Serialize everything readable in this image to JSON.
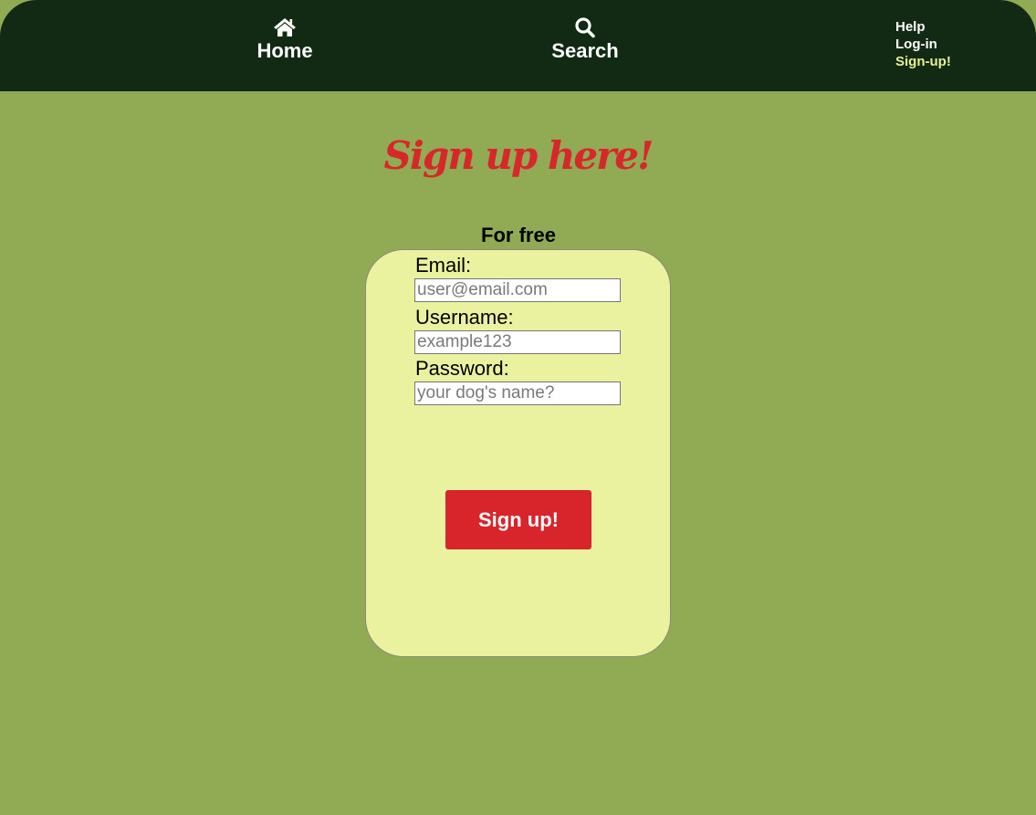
{
  "nav": {
    "home": {
      "label": "Home",
      "icon": "home-icon"
    },
    "search": {
      "label": "Search",
      "icon": "search-icon"
    },
    "links": {
      "help": "Help",
      "login": "Log-in",
      "signup": "Sign-up!"
    }
  },
  "page": {
    "heading": "Sign up here!",
    "subheading": "For free"
  },
  "form": {
    "email": {
      "label": "Email:",
      "placeholder": "user@email.com",
      "value": ""
    },
    "username": {
      "label": "Username:",
      "placeholder": "example123",
      "value": ""
    },
    "password": {
      "label": "Password:",
      "placeholder": "your dog's name?",
      "value": ""
    },
    "submit_label": "Sign up!"
  },
  "colors": {
    "background": "#91aa54",
    "topbar": "#122a14",
    "card": "#eaf29f",
    "accent_red": "#d8252b",
    "active_link": "#e6f08f"
  }
}
